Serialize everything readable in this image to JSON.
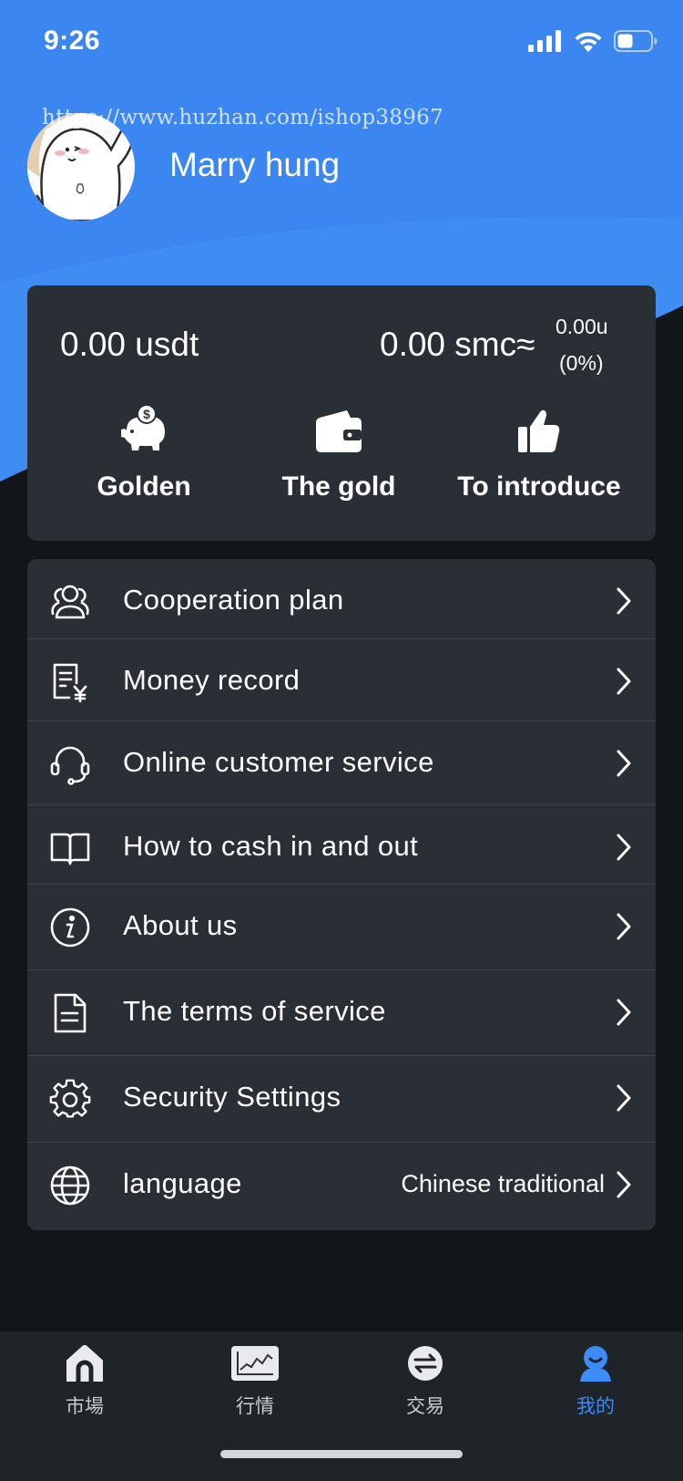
{
  "status": {
    "time": "9:26",
    "icons": [
      "signal-icon",
      "wifi-icon",
      "battery-icon"
    ]
  },
  "watermark": "https://www.huzhan.com/ishop38967",
  "profile": {
    "name": "Marry hung"
  },
  "wallet": {
    "usdt": "0.00 usdt",
    "smc": "0.00 smc≈",
    "smc_u": "0.00u",
    "smc_pct": "(0%)",
    "actions": [
      {
        "label": "Golden",
        "icon": "piggy-bank-icon"
      },
      {
        "label": "The gold",
        "icon": "wallet-icon"
      },
      {
        "label": "To introduce",
        "icon": "thumbs-up-icon"
      }
    ]
  },
  "menu": [
    {
      "label": "Cooperation plan",
      "icon": "users-icon"
    },
    {
      "label": "Money record",
      "icon": "receipt-yen-icon"
    },
    {
      "label": "Online customer service",
      "icon": "headset-icon"
    },
    {
      "label": "How to cash in and out",
      "icon": "book-icon"
    },
    {
      "label": "About us",
      "icon": "info-icon"
    },
    {
      "label": "The terms of service",
      "icon": "document-icon"
    },
    {
      "label": "Security Settings",
      "icon": "gear-icon"
    },
    {
      "label": "language",
      "icon": "globe-icon",
      "value": "Chinese traditional"
    }
  ],
  "tabs": [
    {
      "label": "市場",
      "icon": "market-home-icon"
    },
    {
      "label": "行情",
      "icon": "chart-icon"
    },
    {
      "label": "交易",
      "icon": "exchange-icon"
    },
    {
      "label": "我的",
      "icon": "profile-icon",
      "active": true
    }
  ],
  "colors": {
    "accent": "#3d8bf5",
    "hero": "#3b86f0",
    "card": "#2a2f35",
    "background": "#121619"
  }
}
